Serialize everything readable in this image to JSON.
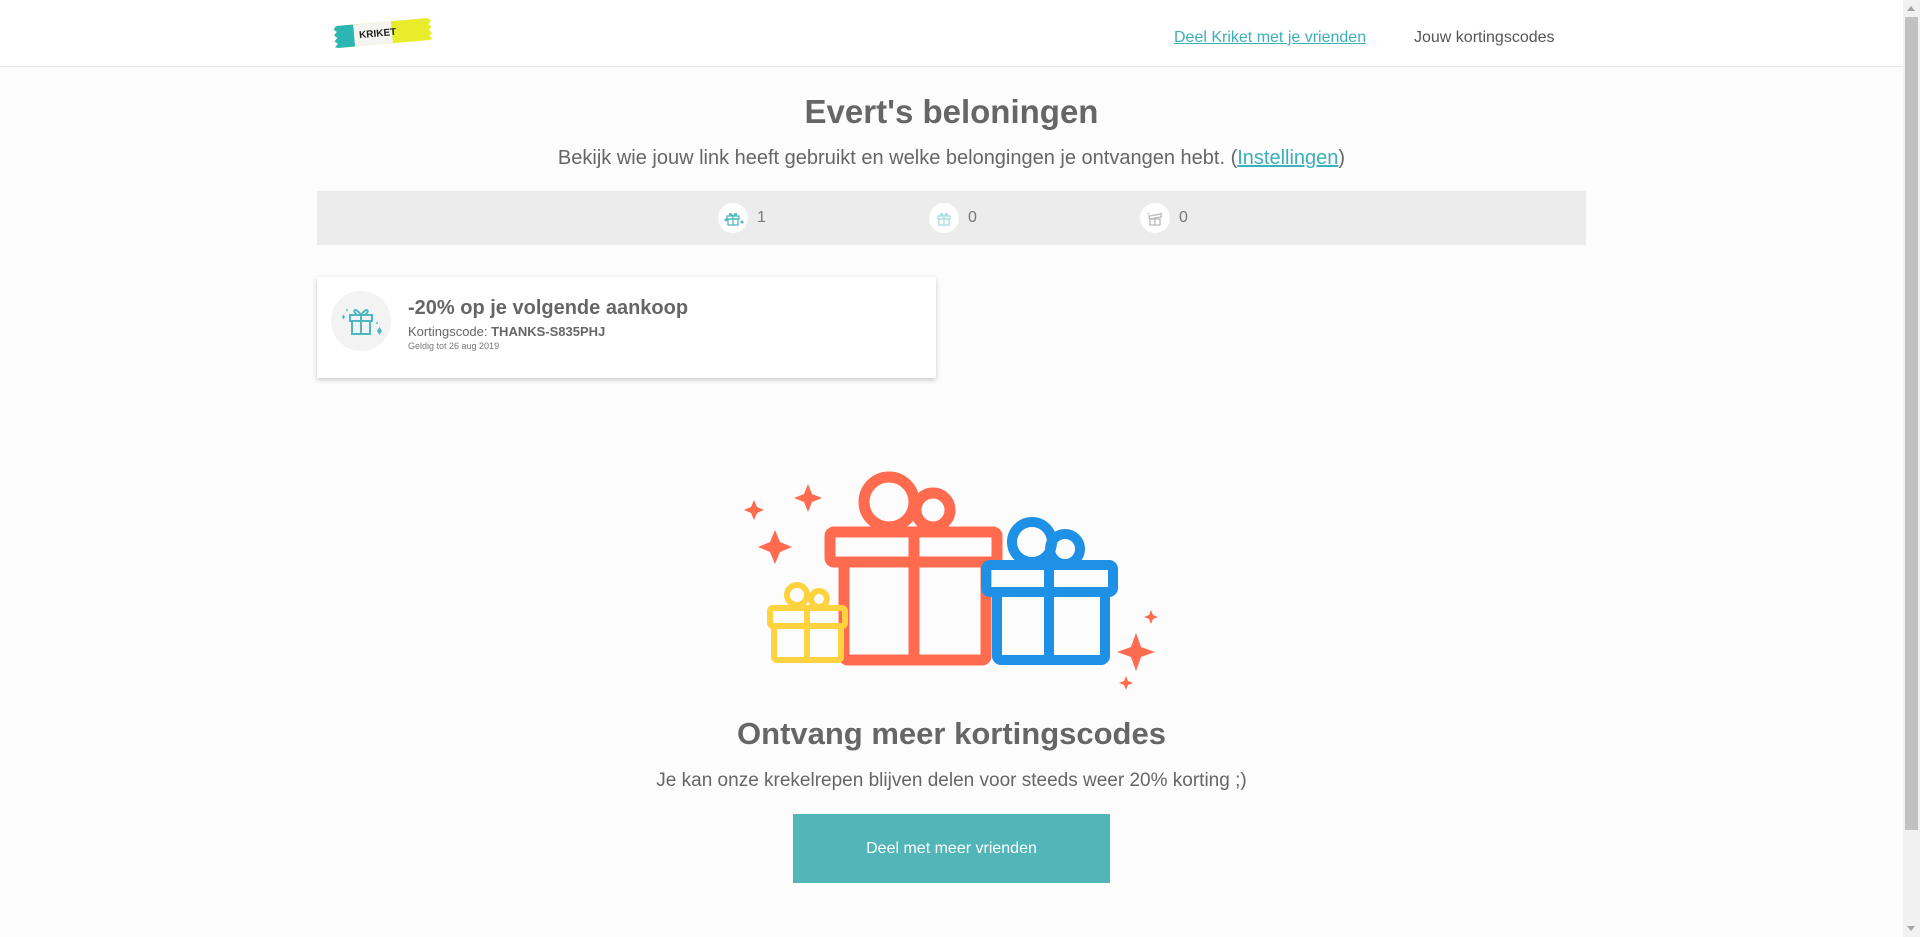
{
  "header": {
    "logo_text": "KRIKET",
    "nav_share_label": "Deel Kriket met je vrienden",
    "nav_codes_label": "Jouw kortingscodes"
  },
  "page": {
    "title": "Evert's beloningen",
    "subtitle_text": "Bekijk wie jouw link heeft gebruikt en welke belongingen je ontvangen hebt. (",
    "settings_link": "Instellingen",
    "subtitle_close": ")"
  },
  "stats": [
    {
      "icon": "gift-sparkle-icon",
      "value": "1"
    },
    {
      "icon": "gift-icon",
      "value": "0"
    },
    {
      "icon": "gift-open-icon",
      "value": "0"
    }
  ],
  "reward": {
    "title": "-20% op je volgende aankoop",
    "code_label": "Kortingscode: ",
    "code": "THANKS-S835PHJ",
    "valid_until": "Geldig tot 26 aug 2019"
  },
  "cta": {
    "title": "Ontvang meer kortingscodes",
    "subtitle": "Je kan onze krekelrepen blijven delen voor steeds weer 20% korting ;)",
    "button_label": "Deel met meer vrienden"
  },
  "colors": {
    "accent": "#3ab0b8",
    "button": "#52b5b8",
    "gift_orange": "#ff6b4f",
    "gift_blue": "#1e90e6",
    "gift_yellow": "#ffd23f"
  }
}
